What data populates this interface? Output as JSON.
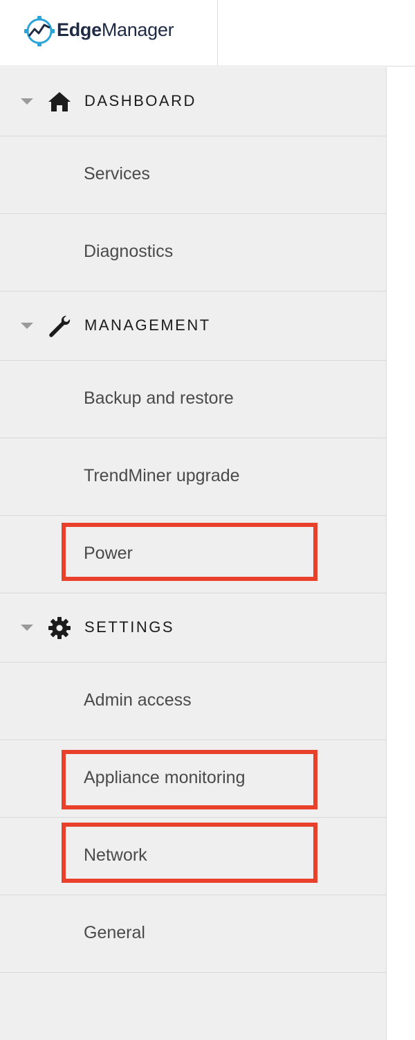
{
  "header": {
    "logo_icon": "gear-chart-logo-icon",
    "logo_text_bold": "Edge",
    "logo_text_regular": "Manager"
  },
  "sidebar": {
    "sections": [
      {
        "label": "DASHBOARD",
        "icon": "home-icon",
        "caret": "caret-down-icon"
      },
      {
        "label": "MANAGEMENT",
        "icon": "wrench-icon",
        "caret": "caret-down-icon"
      },
      {
        "label": "SETTINGS",
        "icon": "gear-icon",
        "caret": "caret-down-icon"
      }
    ],
    "items": [
      {
        "label": "Services"
      },
      {
        "label": "Diagnostics"
      },
      {
        "label": "Backup and restore"
      },
      {
        "label": "TrendMiner upgrade"
      },
      {
        "label": "Power",
        "highlighted": true
      },
      {
        "label": "Admin access"
      },
      {
        "label": "Appliance monitoring",
        "highlighted": true
      },
      {
        "label": "Network",
        "highlighted": true
      },
      {
        "label": "General"
      }
    ]
  },
  "colors": {
    "highlight": "#e8402a",
    "sidebar_bg": "#efefef",
    "logo_accent": "#2aa3d8",
    "logo_text": "#1f2a44"
  }
}
